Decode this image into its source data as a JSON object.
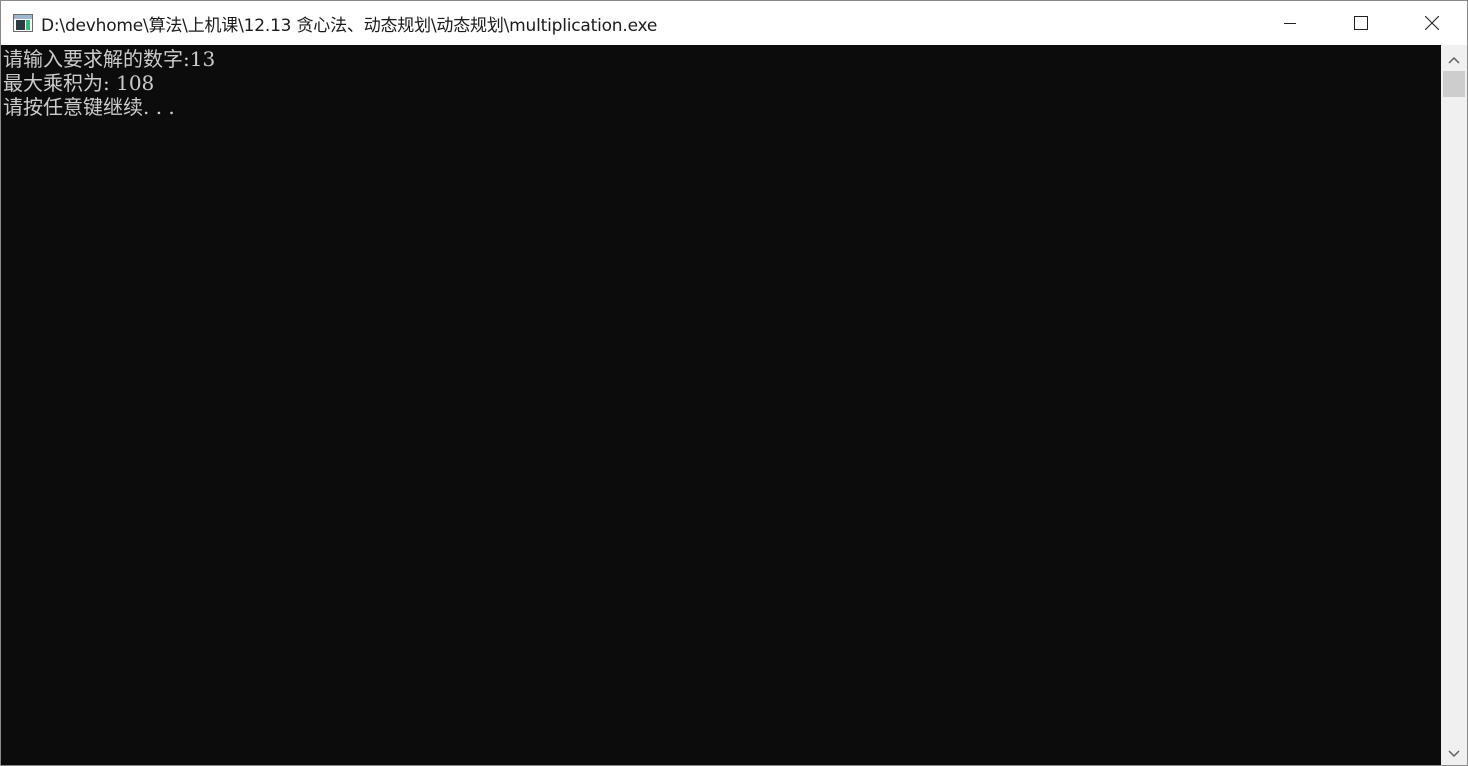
{
  "window": {
    "title": "D:\\devhome\\算法\\上机课\\12.13 贪心法、动态规划\\动态规划\\multiplication.exe",
    "icon": "console-app-icon"
  },
  "controls": {
    "minimize": "minimize-icon",
    "maximize": "maximize-icon",
    "close": "close-icon"
  },
  "console": {
    "lines": [
      "请输入要求解的数字:13",
      "最大乘积为: 108",
      "请按任意键继续. . ."
    ],
    "text_color": "#cccccc",
    "background_color": "#0c0c0c"
  }
}
